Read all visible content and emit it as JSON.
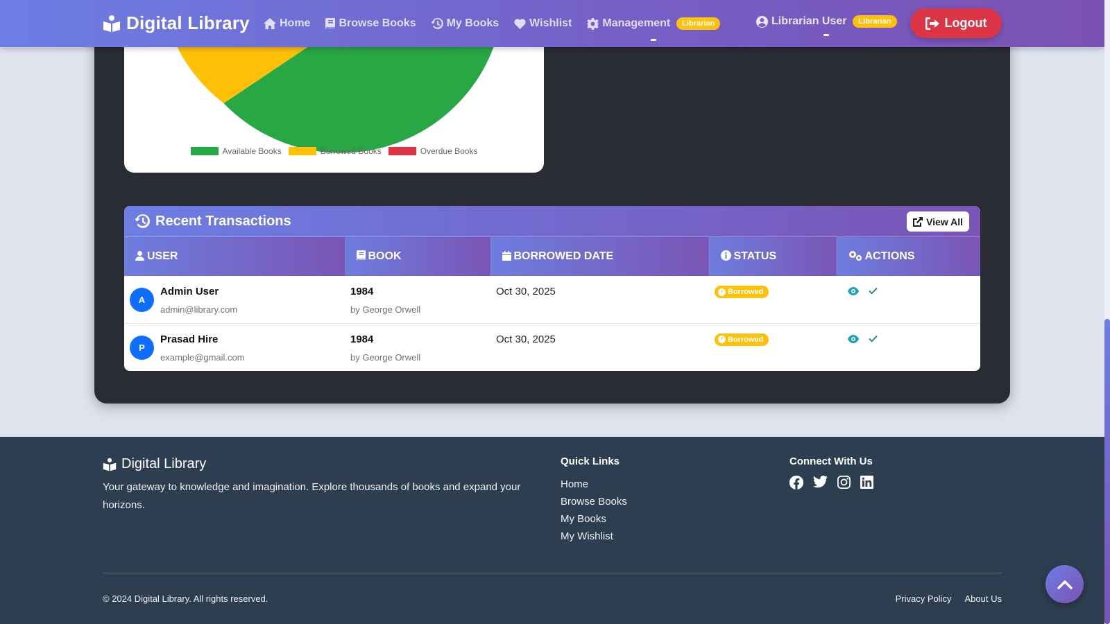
{
  "nav": {
    "brand": "Digital Library",
    "items": [
      {
        "label": "Home",
        "icon": "home-icon"
      },
      {
        "label": "Browse Books",
        "icon": "book-icon"
      },
      {
        "label": "My Books",
        "icon": "history-icon"
      },
      {
        "label": "Wishlist",
        "icon": "heart-icon"
      },
      {
        "label": "Management",
        "icon": "gear-icon",
        "badge": "Librarian"
      }
    ],
    "user_name": "Librarian User",
    "user_badge": "Librarian",
    "logout_label": "Logout"
  },
  "chart_data": {
    "type": "pie",
    "categories": [
      "Available Books",
      "Borrowed Books",
      "Overdue Books"
    ],
    "colors": [
      "#28a745",
      "#ffc107",
      "#dc3545"
    ]
  },
  "transactions": {
    "title": "Recent Transactions",
    "view_all_label": "View All",
    "columns": [
      "USER",
      "BOOK",
      "BORROWED DATE",
      "STATUS",
      "ACTIONS"
    ],
    "rows": [
      {
        "initial": "A",
        "name": "Admin User",
        "email": "admin@library.com",
        "book": "1984",
        "author": "by George Orwell",
        "date": "Oct 30, 2025",
        "status": "Borrowed"
      },
      {
        "initial": "P",
        "name": "Prasad Hire",
        "email": "example@gmail.com",
        "book": "1984",
        "author": "by George Orwell",
        "date": "Oct 30, 2025",
        "status": "Borrowed"
      }
    ]
  },
  "footer": {
    "brand": "Digital Library",
    "description": "Your gateway to knowledge and imagination. Explore thousands of books and expand your horizons.",
    "quick_links_title": "Quick Links",
    "quick_links": [
      "Home",
      "Browse Books",
      "My Books",
      "My Wishlist"
    ],
    "connect_title": "Connect With Us",
    "socials": [
      "facebook-icon",
      "twitter-icon",
      "instagram-icon",
      "linkedin-icon"
    ],
    "copyright": "© 2024 Digital Library. All rights reserved.",
    "bottom_links": [
      "Privacy Policy",
      "About Us"
    ]
  },
  "colors": {
    "nav_gradient_start": "#6c7ee4",
    "nav_gradient_end": "#7b52b3",
    "dark_card": "#292c33",
    "footer_bg": "#2d3e50",
    "logout": "#dc3545",
    "badge": "#ffc107",
    "avatar": "#0d6efd",
    "view_icon": "#17a2b8",
    "check_icon": "#198754"
  }
}
